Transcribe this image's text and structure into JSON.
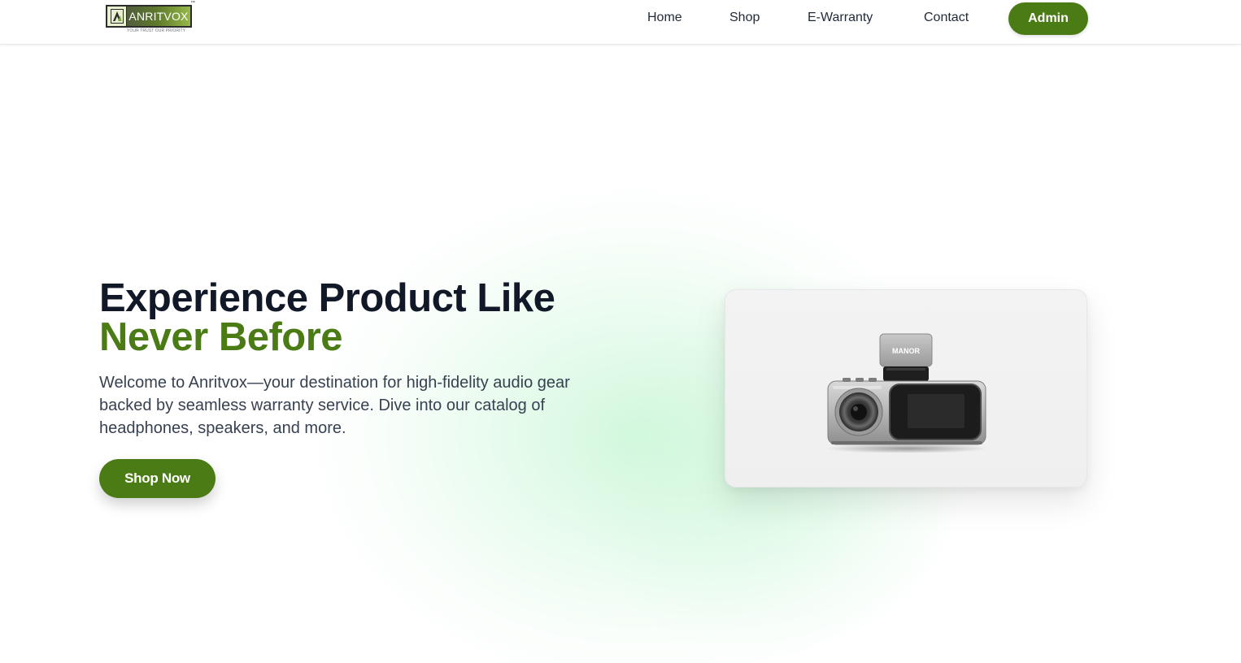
{
  "brand": {
    "name": "ANRITVOX",
    "trademark": "™",
    "tagline": "YOUR TRUST OUR PRIORITY"
  },
  "nav": {
    "items": [
      {
        "label": "Home"
      },
      {
        "label": "Shop"
      },
      {
        "label": "E-Warranty"
      },
      {
        "label": "Contact"
      }
    ],
    "admin_label": "Admin"
  },
  "hero": {
    "headline_line1": "Experience Product Like",
    "headline_line2": "Never Before",
    "description": "Welcome to Anritvox—your destination for high-fidelity audio gear backed by seamless warranty service. Dive into our catalog of headphones, speakers, and more.",
    "cta_label": "Shop Now",
    "product_brand_label": "MANOR"
  },
  "colors": {
    "accent": "#4b7b14",
    "heading": "#111827",
    "body_text": "#374151",
    "glow": "#c6f6d4"
  },
  "icons": {
    "logo_mark": "anritvox-a-mark-icon"
  }
}
